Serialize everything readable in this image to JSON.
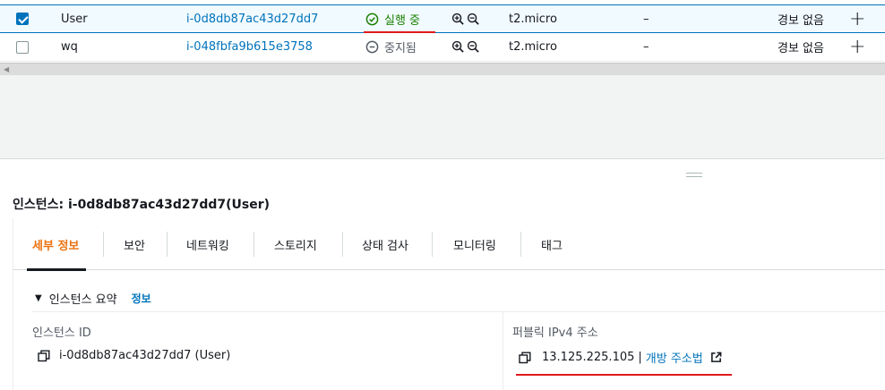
{
  "instances": [
    {
      "selected": true,
      "name": "User",
      "id": "i-0d8db87ac43d27dd7",
      "state": "실행 중",
      "state_kind": "running",
      "type": "t2.micro",
      "dash": "–",
      "alarm": "경보 없음",
      "plus": "+"
    },
    {
      "selected": false,
      "name": "wq",
      "id": "i-048fbfa9b615e3758",
      "state": "중지됨",
      "state_kind": "stopped",
      "type": "t2.micro",
      "dash": "–",
      "alarm": "경보 없음",
      "plus": "+"
    }
  ],
  "panel": {
    "title": "인스턴스: i-0d8db87ac43d27dd7(User)"
  },
  "tabs": [
    "세부 정보",
    "보안",
    "네트워킹",
    "스토리지",
    "상태 검사",
    "모니터링",
    "태그"
  ],
  "summary": {
    "heading": "인스턴스 요약",
    "info": "정보",
    "instance_id_label": "인스턴스 ID",
    "instance_id_value": "i-0d8db87ac43d27dd7 (User)",
    "public_ip_label": "퍼블릭 IPv4 주소",
    "public_ip_value": "13.125.225.105",
    "separator": "|",
    "open_address": "개방 주소법"
  },
  "colors": {
    "accent": "#0073bb",
    "running": "#1d8102",
    "active_tab": "#ec7211",
    "annotation": "#e0191c"
  }
}
